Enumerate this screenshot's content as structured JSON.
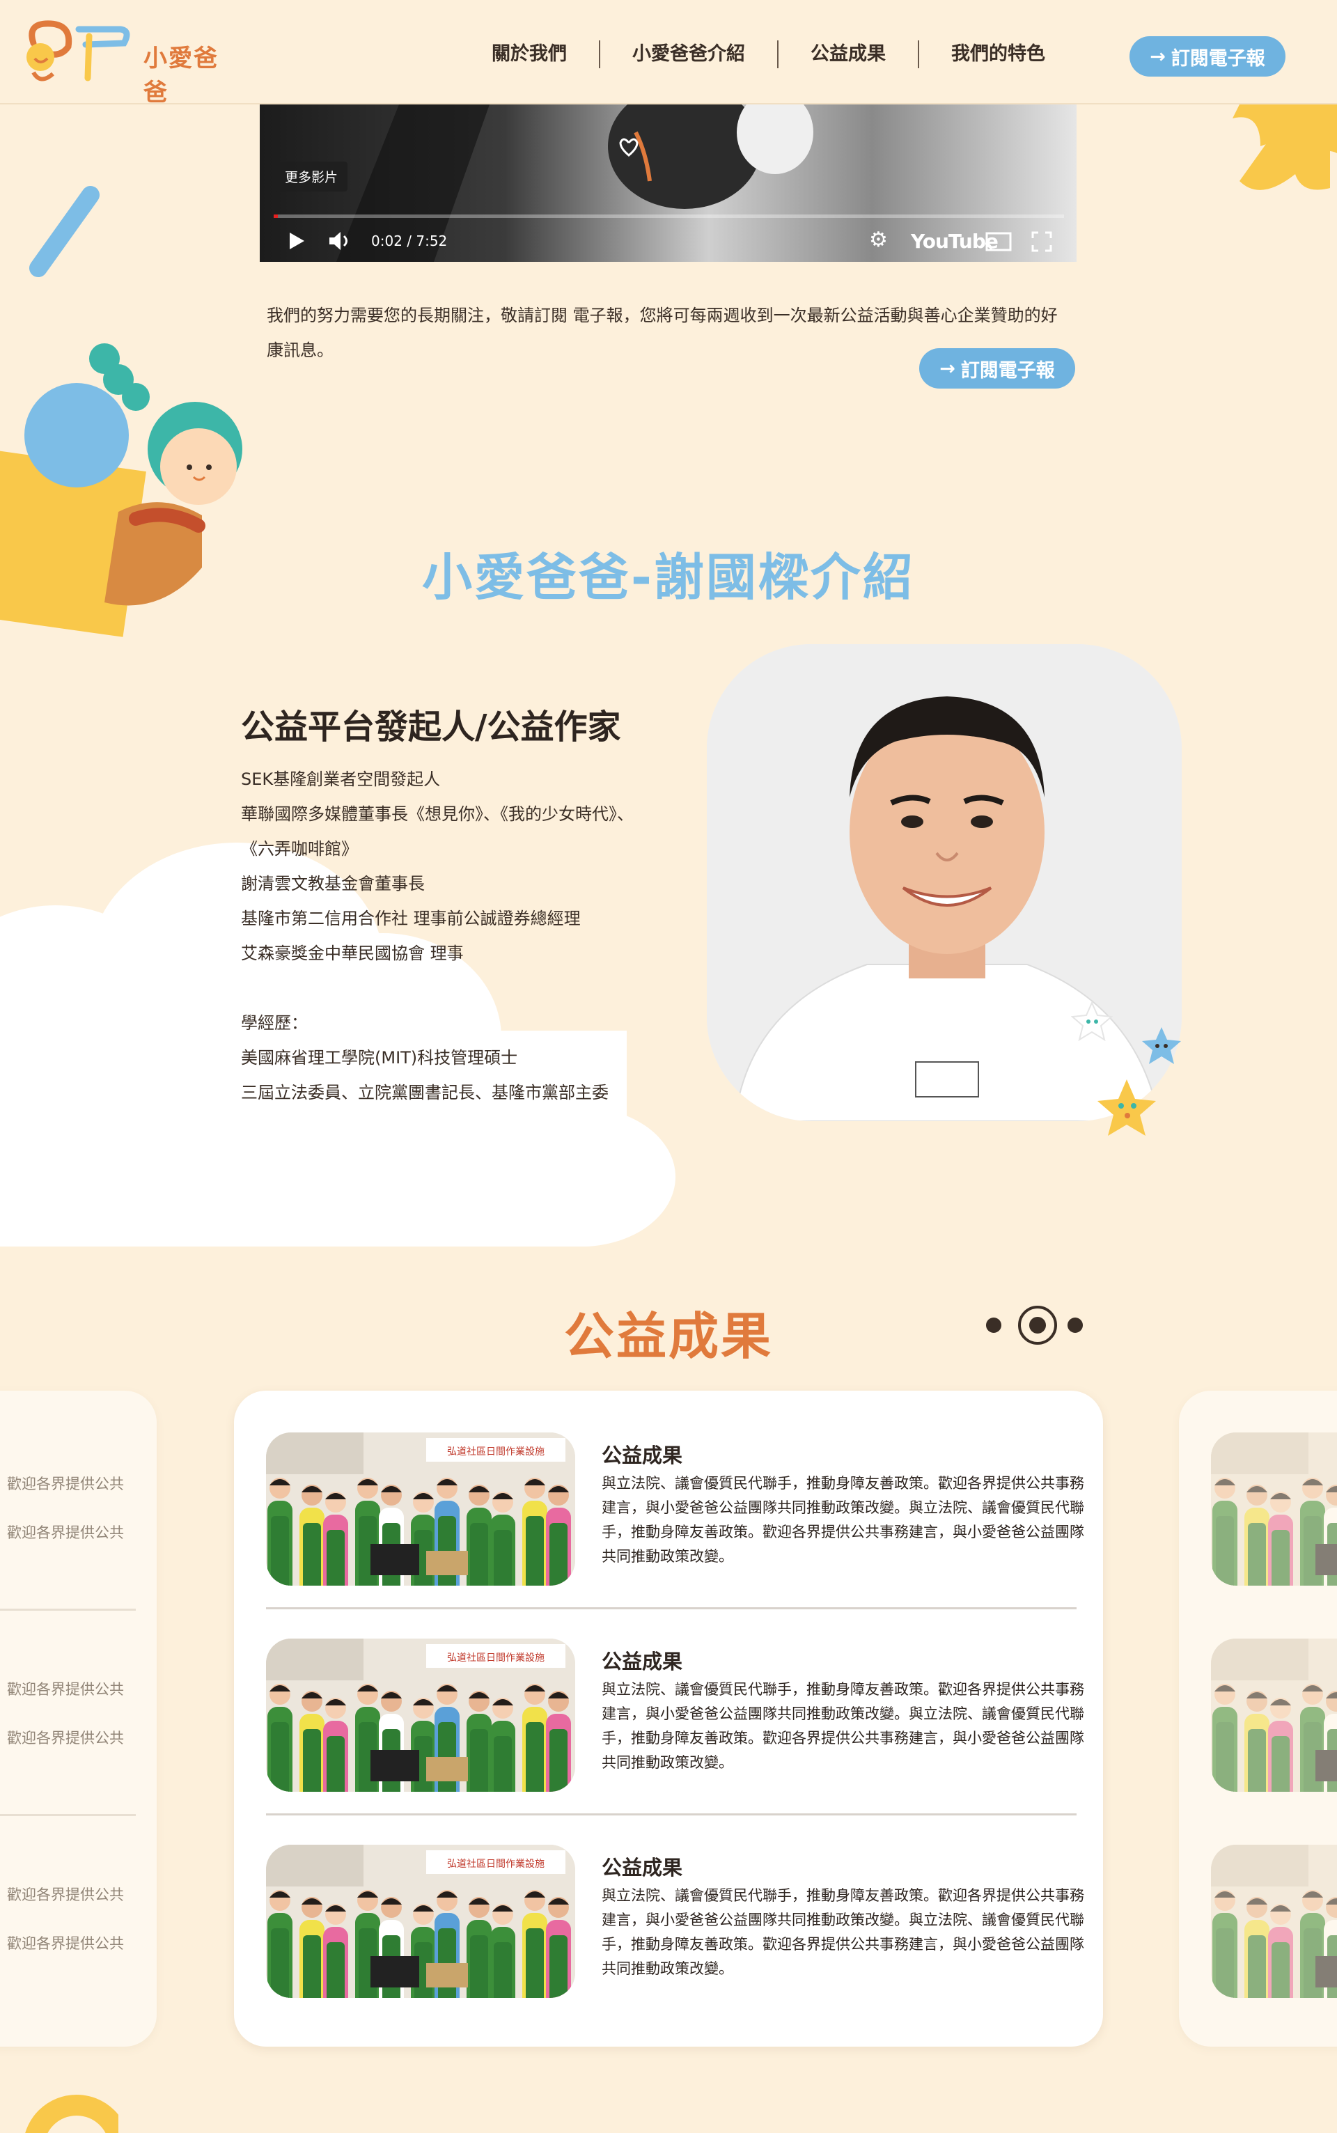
{
  "header": {
    "logo_text": "小愛爸爸",
    "nav": [
      "關於我們",
      "小愛爸爸介紹",
      "公益成果",
      "我們的特色"
    ],
    "subscribe_label": "訂閱電子報"
  },
  "video": {
    "more_videos_label": "更多影片",
    "time": "0:02 / 7:52",
    "brand": "YouTube",
    "progress": 0.004
  },
  "intro": {
    "text": "我們的努力需要您的長期關注，敬請訂閱 電子報，您將可每兩週收到一次最新公益活動與善心企業贊助的好康訊息。",
    "subscribe_label": "訂閱電子報"
  },
  "profile": {
    "section_title": "小愛爸爸-謝國樑介紹",
    "heading": "公益平台發起人/公益作家",
    "lines": [
      "SEK基隆創業者空間發起人",
      "華聯國際多媒體董事長《想見你》、《我的少女時代》、",
      "《六弄咖啡館》",
      "謝清雲文教基金會董事長",
      "基隆市第二信用合作社 理事前公誠證券總經理",
      "艾森豪獎金中華民國協會 理事"
    ],
    "education_label": "學經歷：",
    "education": [
      "美國麻省理工學院(MIT)科技管理碩士",
      "三屆立法委員、立院黨團書記長、基隆市黨部主委"
    ]
  },
  "results": {
    "section_title": "公益成果",
    "carousel_page": 2,
    "carousel_total": 3,
    "items": [
      {
        "title": "公益成果",
        "desc": "與立法院、議會優質民代聯手，推動身障友善政策。歡迎各界提供公共事務建言，與小愛爸爸公益團隊共同推動政策改變。與立法院、議會優質民代聯手，推動身障友善政策。歡迎各界提供公共事務建言，與小愛爸爸公益團隊共同推動政策改變。",
        "banner": "弘道社區日間作業設施"
      },
      {
        "title": "公益成果",
        "desc": "與立法院、議會優質民代聯手，推動身障友善政策。歡迎各界提供公共事務建言，與小愛爸爸公益團隊共同推動政策改變。與立法院、議會優質民代聯手，推動身障友善政策。歡迎各界提供公共事務建言，與小愛爸爸公益團隊共同推動政策改變。",
        "banner": "弘道社區日間作業設施"
      },
      {
        "title": "公益成果",
        "desc": "與立法院、議會優質民代聯手，推動身障友善政策。歡迎各界提供公共事務建言，與小愛爸爸公益團隊共同推動政策改變。與立法院、議會優質民代聯手，推動身障友善政策。歡迎各界提供公共事務建言，與小愛爸爸公益團隊共同推動政策改變。",
        "banner": "弘道社區日間作業設施"
      }
    ],
    "side_snippet": "歡迎各界提供公共"
  },
  "colors": {
    "background": "#fdf0db",
    "accent_blue": "#6fb3e0",
    "accent_orange": "#e07a3c",
    "accent_yellow": "#f9c84a"
  }
}
